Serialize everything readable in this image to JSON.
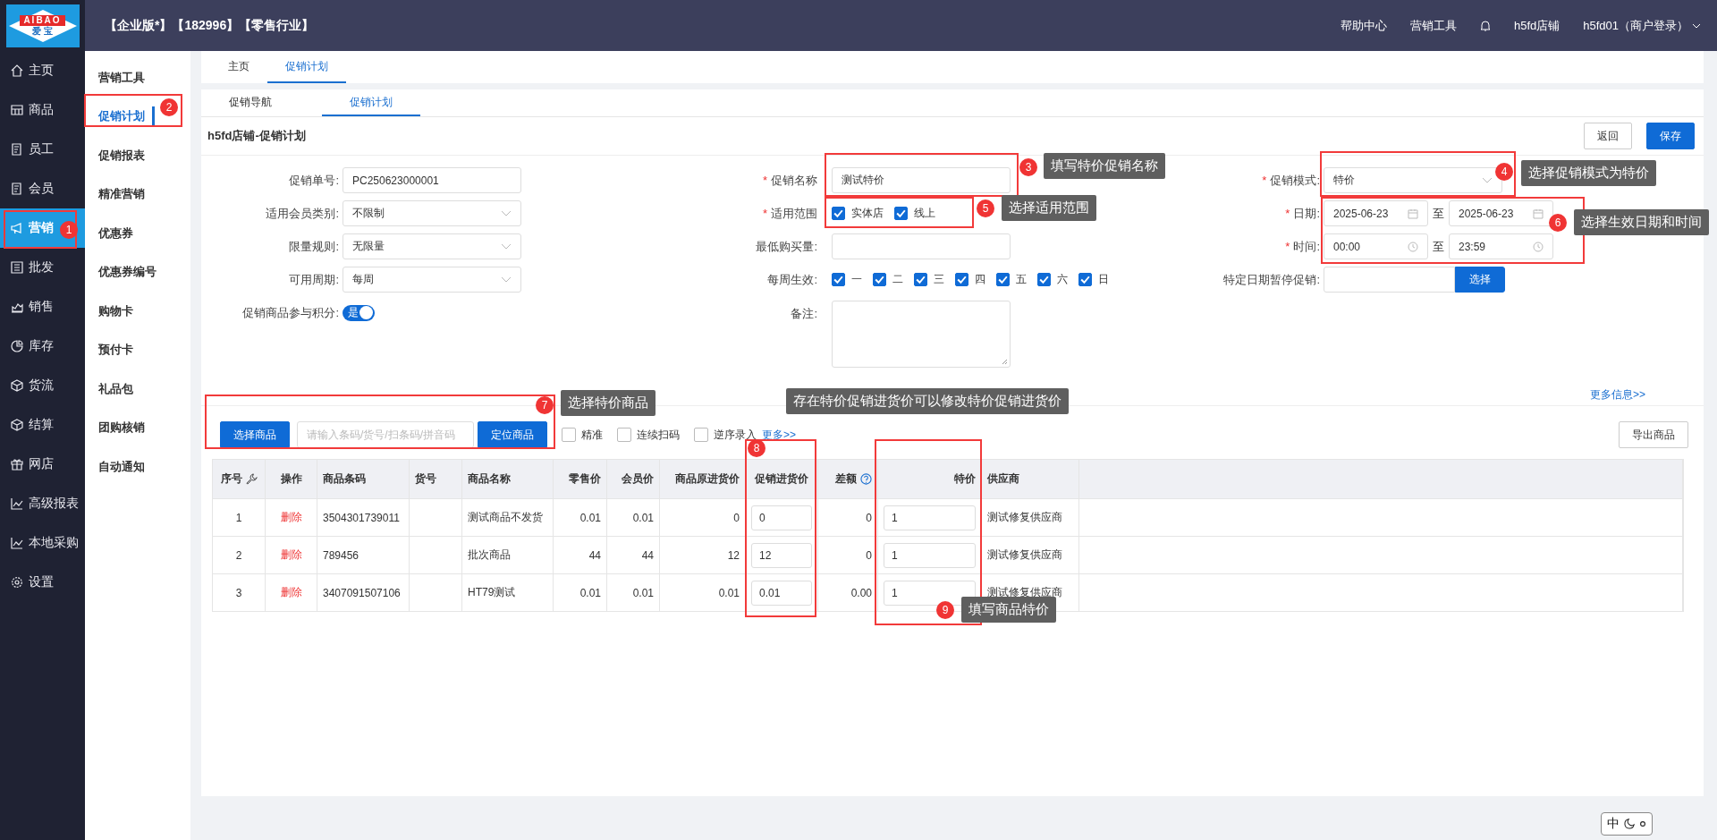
{
  "logo": {
    "text": "AIBAO",
    "subtext": "爱 宝"
  },
  "top_bar": {
    "title": "【企业版*】【182996】【零售行业】",
    "links": [
      "帮助中心",
      "营销工具"
    ],
    "store": "h5fd店铺",
    "user": "h5fd01（商户登录）"
  },
  "sidebar": {
    "items": [
      {
        "label": "主页",
        "selected": false
      },
      {
        "label": "商品",
        "selected": false
      },
      {
        "label": "员工",
        "selected": false
      },
      {
        "label": "会员",
        "selected": false
      },
      {
        "label": "营销",
        "selected": true
      },
      {
        "label": "批发",
        "selected": false
      },
      {
        "label": "销售",
        "selected": false
      },
      {
        "label": "库存",
        "selected": false
      },
      {
        "label": "货流",
        "selected": false
      },
      {
        "label": "结算",
        "selected": false
      },
      {
        "label": "网店",
        "selected": false
      },
      {
        "label": "高级报表",
        "selected": false
      },
      {
        "label": "本地采购",
        "selected": false
      },
      {
        "label": "设置",
        "selected": false
      }
    ]
  },
  "submenu": {
    "items": [
      {
        "label": "营销工具",
        "selected": false
      },
      {
        "label": "促销计划",
        "selected": true
      },
      {
        "label": "促销报表",
        "selected": false
      },
      {
        "label": "精准营销",
        "selected": false
      },
      {
        "label": "优惠券",
        "selected": false
      },
      {
        "label": "优惠券编号",
        "selected": false
      },
      {
        "label": "购物卡",
        "selected": false
      },
      {
        "label": "预付卡",
        "selected": false
      },
      {
        "label": "礼品包",
        "selected": false
      },
      {
        "label": "团购核销",
        "selected": false
      },
      {
        "label": "自动通知",
        "selected": false
      }
    ]
  },
  "page_tabs": [
    {
      "label": "主页",
      "selected": false
    },
    {
      "label": "促销计划",
      "selected": true
    }
  ],
  "sub_tabs": [
    {
      "label": "促销导航",
      "selected": false
    },
    {
      "label": "促销计划",
      "selected": true
    }
  ],
  "panel": {
    "title": "h5fd店铺-促销计划",
    "buttons": [
      {
        "label": "返回",
        "kind": "default"
      },
      {
        "label": "保存",
        "kind": "primary"
      }
    ]
  },
  "form": {
    "columns": [
      [
        {
          "label": "促销单号:",
          "kind": "text",
          "value": "PC250623000001"
        },
        {
          "label": "适用会员类别:",
          "kind": "select",
          "value": "不限制"
        },
        {
          "label": "限量规则:",
          "kind": "select",
          "value": "无限量"
        },
        {
          "label": "可用周期:",
          "kind": "select",
          "value": "每周"
        },
        {
          "label": "促销商品参与积分:",
          "kind": "toggle",
          "on": true,
          "value": "是"
        }
      ],
      [
        {
          "required_mark": "*",
          "label": "促销名称",
          "kind": "text",
          "value": "测试特价"
        },
        {
          "required_mark": "*",
          "label": "适用范围",
          "kind": "checks",
          "options": [
            {
              "label": "实体店",
              "checked": true
            },
            {
              "label": "线上",
              "checked": true
            }
          ]
        },
        {
          "label": "最低购买量:",
          "kind": "text"
        },
        {
          "label": "每周生效:",
          "kind": "checks",
          "options": [
            {
              "label": "一",
              "checked": true
            },
            {
              "label": "二",
              "checked": true
            },
            {
              "label": "三",
              "checked": true
            },
            {
              "label": "四",
              "checked": true
            },
            {
              "label": "五",
              "checked": true
            },
            {
              "label": "六",
              "checked": true
            },
            {
              "label": "日",
              "checked": true
            }
          ]
        },
        {
          "label": "备注:",
          "kind": "textarea"
        }
      ],
      [
        {
          "required_mark": "*",
          "label": "促销模式:",
          "kind": "select",
          "value": "特价"
        },
        {
          "required_mark": "*",
          "label": "日期:",
          "kind": "date_range",
          "from": "2025-06-23",
          "separator": "至",
          "to": "2025-06-23"
        },
        {
          "required_mark": "*",
          "label": "时间:",
          "kind": "time_range",
          "from": "00:00",
          "separator": "至",
          "to": "23:59"
        },
        {
          "label": "特定日期暂停促销:",
          "kind": "picker",
          "button": "选择"
        }
      ]
    ],
    "more_link": "更多信息>>"
  },
  "toolbar": {
    "select_button": "选择商品",
    "search_placeholder": "请输入条码/货号/扫条码/拼音码",
    "locate_button": "定位商品",
    "options": [
      {
        "label": "精准",
        "checked": false
      },
      {
        "label": "连续扫码",
        "checked": false
      },
      {
        "label": "逆序录入",
        "checked": false
      }
    ],
    "more_link": "更多>>",
    "export_button": "导出商品"
  },
  "table": {
    "columns": [
      {
        "label": "序号",
        "kind": "center"
      },
      {
        "label": "操作",
        "kind": "link"
      },
      {
        "label": "商品条码",
        "kind": "text"
      },
      {
        "label": "货号",
        "kind": "text"
      },
      {
        "label": "商品名称",
        "kind": "text"
      },
      {
        "label": "零售价",
        "kind": "number"
      },
      {
        "label": "会员价",
        "kind": "number"
      },
      {
        "label": "商品原进货价",
        "kind": "number"
      },
      {
        "label": "促销进货价",
        "kind": "input"
      },
      {
        "label": "差额",
        "kind": "number"
      },
      {
        "label": "特价",
        "kind": "input"
      },
      {
        "label": "供应商",
        "kind": "text"
      }
    ],
    "rows": [
      {
        "no": "1",
        "action": "删除",
        "barcode": "3504301739011",
        "name": "测试商品不发货",
        "retail": "0.01",
        "member": "0.01",
        "cost": "0",
        "promo_cost": "0",
        "diff": "0",
        "special_price": "1",
        "supplier": "测试修复供应商"
      },
      {
        "no": "2",
        "action": "删除",
        "barcode": "789456",
        "name": "批次商品",
        "retail": "44",
        "member": "44",
        "cost": "12",
        "promo_cost": "12",
        "diff": "0",
        "special_price": "1",
        "supplier": "测试修复供应商"
      },
      {
        "no": "3",
        "action": "删除",
        "barcode": "3407091507106",
        "name": "HT79测试",
        "retail": "0.01",
        "member": "0.01",
        "cost": "0.01",
        "promo_cost": "0.01",
        "diff": "0.00",
        "special_price": "1",
        "supplier": "测试修复供应商"
      }
    ]
  },
  "annotations": [
    {
      "number": "1"
    },
    {
      "number": "2"
    },
    {
      "number": "3",
      "text": "填写特价促销名称"
    },
    {
      "number": "4",
      "text": "选择促销模式为特价"
    },
    {
      "number": "5",
      "text": "选择适用范围"
    },
    {
      "number": "6",
      "text": "选择生效日期和时间"
    },
    {
      "number": "7",
      "text": "选择特价商品"
    },
    {
      "number": "8",
      "text": "存在特价促销进货价可以修改特价促销进货价"
    },
    {
      "number": "9",
      "text": "填写商品特价"
    }
  ],
  "ime": {
    "label": "中"
  }
}
